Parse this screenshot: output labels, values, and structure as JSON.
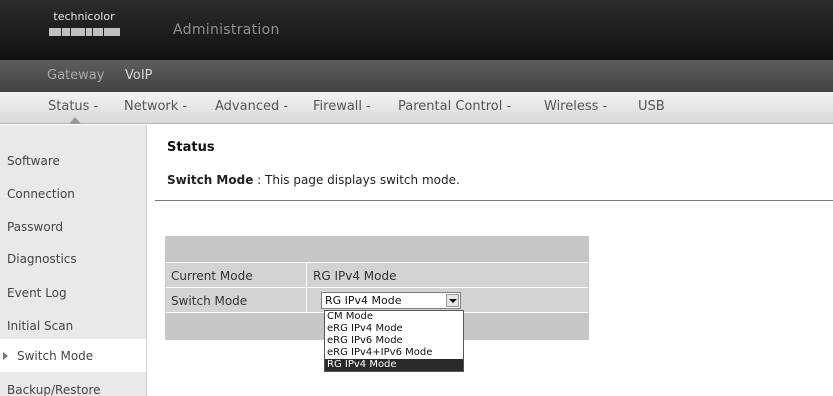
{
  "brand": {
    "logo_text": "technicolor",
    "admin_title": "Administration"
  },
  "subnav": {
    "items": [
      "Gateway",
      "VoIP"
    ]
  },
  "mainnav": {
    "items": [
      "Status -",
      "Network -",
      "Advanced -",
      "Firewall -",
      "Parental Control -",
      "Wireless -",
      "USB"
    ],
    "active": "Status -"
  },
  "sidebar": {
    "items": [
      "Software",
      "Connection",
      "Password",
      "Diagnostics",
      "Event Log",
      "Initial Scan",
      "Switch Mode",
      "Backup/Restore"
    ],
    "active": "Switch Mode"
  },
  "content": {
    "title": "Status",
    "desc_label": "Switch Mode",
    "desc_sep": ":",
    "desc_text": "This page displays switch mode."
  },
  "form": {
    "current_mode_label": "Current Mode",
    "current_mode_value": "RG IPv4 Mode",
    "switch_mode_label": "Switch Mode",
    "switch_mode_selected": "RG IPv4 Mode",
    "options": [
      "CM Mode",
      "eRG IPv4 Mode",
      "eRG IPv6 Mode",
      "eRG IPv4+IPv6 Mode",
      "RG IPv4 Mode"
    ]
  }
}
